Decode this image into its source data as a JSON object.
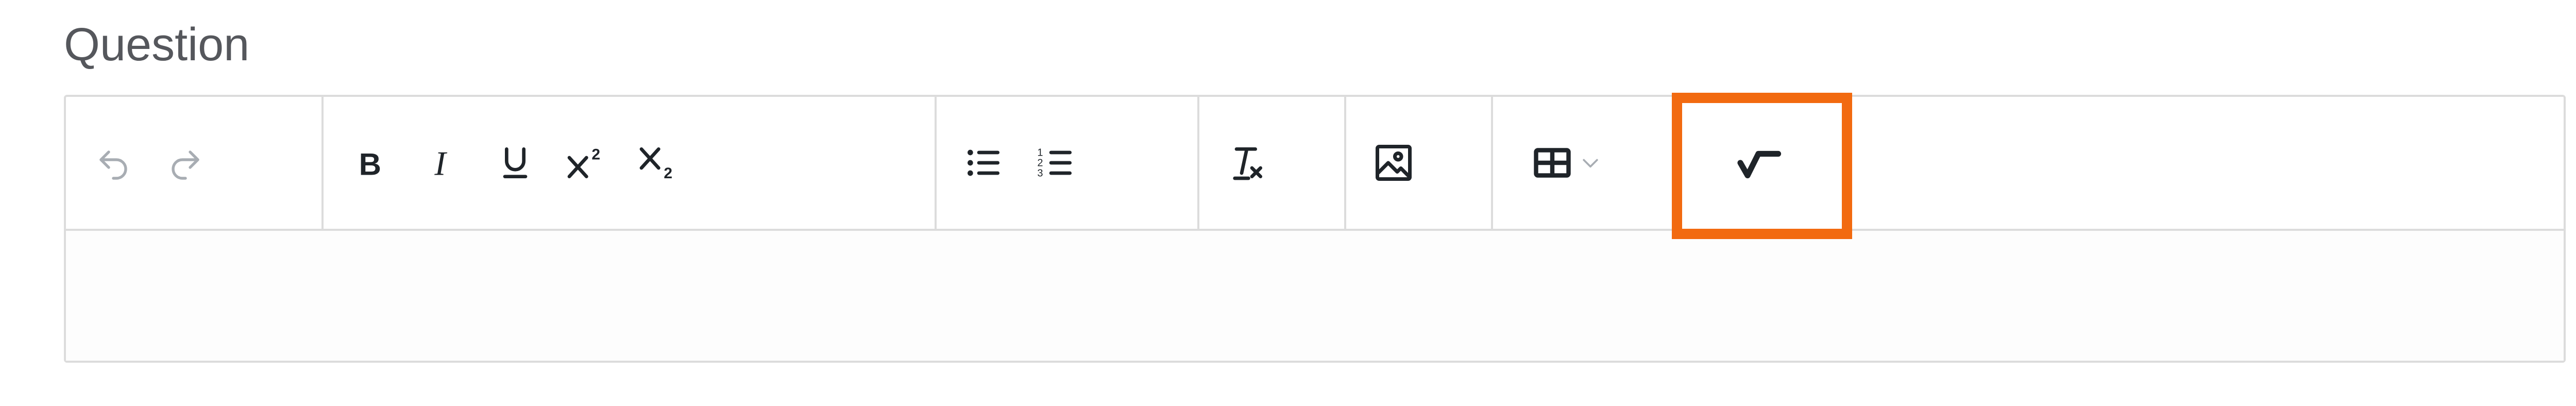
{
  "field": {
    "label": "Question"
  },
  "toolbar": {
    "groups": [
      {
        "name": "history",
        "items": [
          {
            "icon": "undo-icon",
            "title": "Undo"
          },
          {
            "icon": "redo-icon",
            "title": "Redo"
          }
        ]
      },
      {
        "name": "format",
        "items": [
          {
            "icon": "bold-icon",
            "title": "Bold"
          },
          {
            "icon": "italic-icon",
            "title": "Italic"
          },
          {
            "icon": "underline-icon",
            "title": "Underline"
          },
          {
            "icon": "superscript-icon",
            "title": "Superscript"
          },
          {
            "icon": "subscript-icon",
            "title": "Subscript"
          }
        ]
      },
      {
        "name": "lists",
        "items": [
          {
            "icon": "bullet-list-icon",
            "title": "Bulleted list"
          },
          {
            "icon": "numbered-list-icon",
            "title": "Numbered list"
          }
        ]
      },
      {
        "name": "clear",
        "items": [
          {
            "icon": "clear-formatting-icon",
            "title": "Clear formatting"
          }
        ]
      },
      {
        "name": "media",
        "items": [
          {
            "icon": "image-icon",
            "title": "Insert image"
          }
        ]
      },
      {
        "name": "table",
        "items": [
          {
            "icon": "table-icon",
            "title": "Insert table"
          }
        ]
      },
      {
        "name": "math",
        "items": [
          {
            "icon": "square-root-icon",
            "title": "Insert math equation"
          }
        ]
      }
    ]
  },
  "editor": {
    "content": ""
  },
  "colors": {
    "highlight": "#f26a10",
    "border": "#dcdcdc",
    "icon": "#1f2429",
    "icon_disabled": "#a8adb3"
  }
}
